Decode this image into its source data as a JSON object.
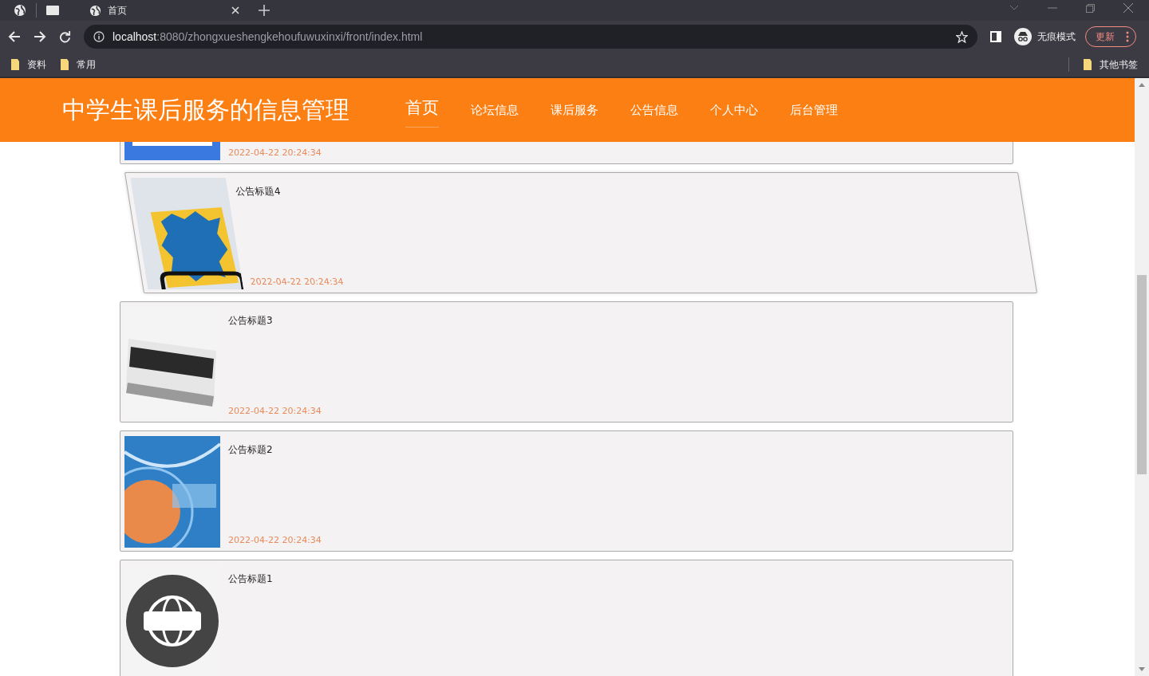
{
  "browser": {
    "tab": {
      "title": "首页"
    },
    "address": {
      "host": "localhost",
      "path": ":8080/zhongxueshengkehoufuwuxinxi/front/index.html"
    },
    "profile": "无痕模式",
    "update_button": "更新",
    "bookmarks": [
      "资料",
      "常用"
    ],
    "other_bookmarks": "其他书签"
  },
  "site": {
    "title": "中学生课后服务的信息管理",
    "nav": [
      {
        "label": "首页",
        "selected": true
      },
      {
        "label": "论坛信息",
        "selected": false
      },
      {
        "label": "课后服务",
        "selected": false
      },
      {
        "label": "公告信息",
        "selected": false
      },
      {
        "label": "个人中心",
        "selected": false
      },
      {
        "label": "后台管理",
        "selected": false
      }
    ]
  },
  "notices": [
    {
      "date": "2022-04-22 20:24:34",
      "hovered": false
    },
    {
      "title": "公告标题4",
      "date": "2022-04-22 20:24:34",
      "hovered": true
    },
    {
      "title": "公告标题3",
      "date": "2022-04-22 20:24:34",
      "hovered": false
    },
    {
      "title": "公告标题2",
      "date": "2022-04-22 20:24:34",
      "hovered": false
    },
    {
      "title": "公告标题1",
      "hovered": false
    }
  ]
}
